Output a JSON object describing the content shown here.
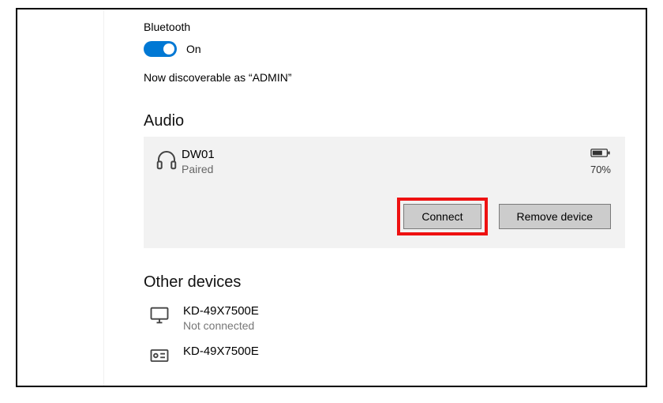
{
  "bluetooth": {
    "label": "Bluetooth",
    "state_label": "On",
    "discoverable_text": "Now discoverable as “ADMIN”"
  },
  "audio": {
    "heading": "Audio",
    "device": {
      "name": "DW01",
      "status": "Paired",
      "battery_pct": "70%",
      "connect_label": "Connect",
      "remove_label": "Remove device"
    }
  },
  "other": {
    "heading": "Other devices",
    "items": [
      {
        "name": "KD-49X7500E",
        "status": "Not connected",
        "icon": "monitor-icon"
      },
      {
        "name": "KD-49X7500E",
        "status": "",
        "icon": "media-device-icon"
      }
    ]
  }
}
